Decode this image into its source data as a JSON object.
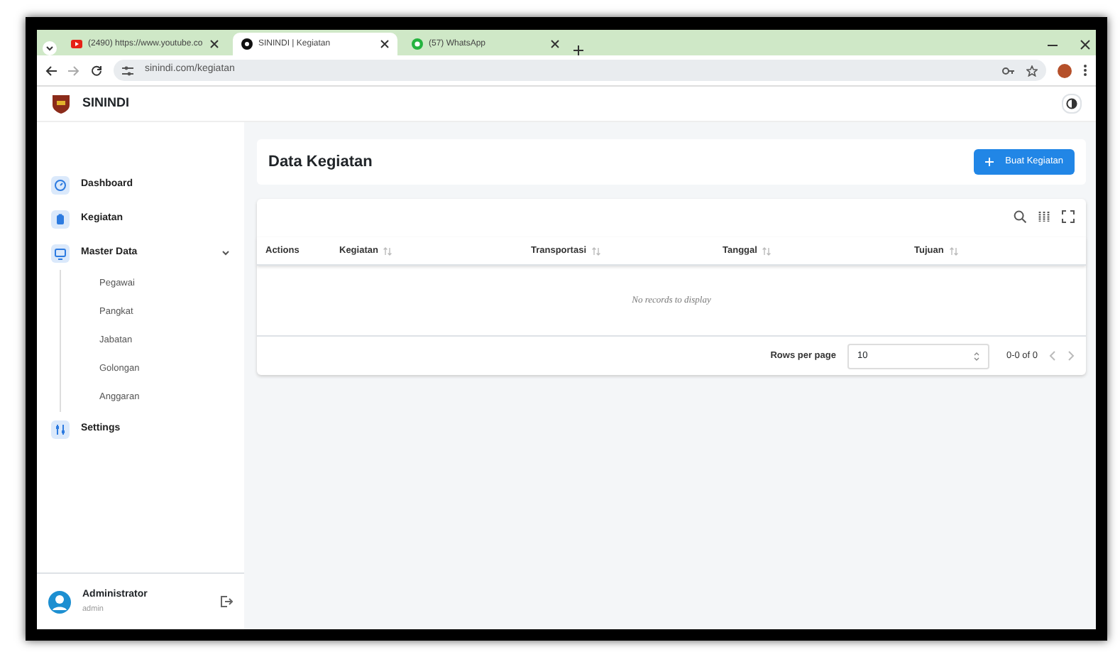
{
  "browser": {
    "tabs": [
      {
        "title": "(2490) https://www.youtube.co",
        "kind": "video",
        "selected": false
      },
      {
        "title": "SININDI | Kegiatan",
        "kind": "app",
        "selected": true
      },
      {
        "title": "(57) WhatsApp",
        "kind": "chat",
        "selected": false
      }
    ],
    "address": "sinindi.com/kegiatan"
  },
  "app": {
    "brand": "SININDI",
    "sidebar": {
      "items": [
        {
          "label": "Dashboard",
          "kind": "gauge"
        },
        {
          "label": "Kegiatan",
          "kind": "clipboard"
        },
        {
          "label": "Master Data",
          "kind": "monitor",
          "expanded": true,
          "children": [
            {
              "label": "Pegawai"
            },
            {
              "label": "Pangkat"
            },
            {
              "label": "Jabatan"
            },
            {
              "label": "Golongan"
            },
            {
              "label": "Anggaran"
            }
          ]
        },
        {
          "label": "Settings",
          "kind": "sliders"
        }
      ],
      "user": {
        "name": "Administrator",
        "role": "admin"
      }
    },
    "page_title": "Data Kegiatan",
    "create_button": "Buat Kegiatan",
    "table": {
      "columns": [
        {
          "label": "Actions",
          "sortable": false
        },
        {
          "label": "Kegiatan",
          "sortable": true
        },
        {
          "label": "Transportasi",
          "sortable": true
        },
        {
          "label": "Tanggal",
          "sortable": true
        },
        {
          "label": "Tujuan",
          "sortable": true
        }
      ],
      "empty_message": "No records to display",
      "footer": {
        "rows_per_page_label": "Rows per page",
        "rows_per_page": "10",
        "range": "0-0 of 0"
      }
    }
  }
}
